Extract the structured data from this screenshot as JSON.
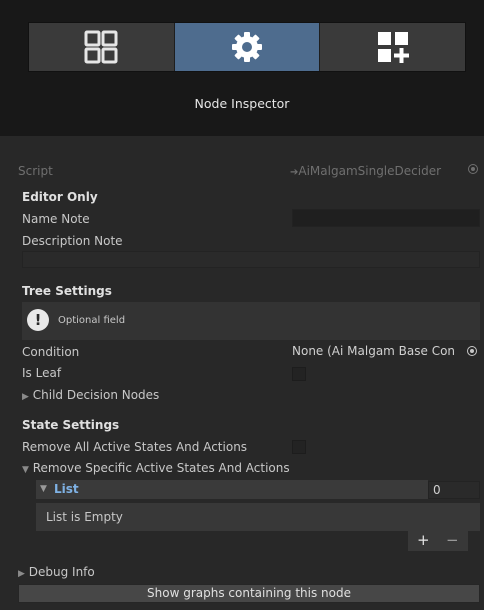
{
  "toolbar": {
    "buttons": [
      {
        "icon": "grid-icon"
      },
      {
        "icon": "gear-icon",
        "active": true
      },
      {
        "icon": "add-block-icon"
      }
    ]
  },
  "title": "Node Inspector",
  "script": {
    "label": "Script",
    "value_arrow": "➔",
    "value": "AiMalgamSingleDecider"
  },
  "editor_only": {
    "header": "Editor Only",
    "name_note_label": "Name Note",
    "name_note_value": "",
    "description_note_label": "Description Note",
    "description_note_value": ""
  },
  "tree_settings": {
    "header": "Tree Settings",
    "info": "Optional field",
    "condition_label": "Condition",
    "condition_value": "None (Ai Malgam Base Con",
    "is_leaf_label": "Is Leaf",
    "is_leaf": false,
    "child_nodes_label": "Child Decision Nodes"
  },
  "state_settings": {
    "header": "State Settings",
    "remove_all_label": "Remove All Active States And Actions",
    "remove_all": false,
    "remove_specific_label": "Remove Specific Active States And Actions",
    "list_label": "List",
    "list_count": "0",
    "list_empty": "List is Empty",
    "add": "+",
    "remove": "−"
  },
  "debug_label": "Debug Info",
  "show_graphs_button": "Show graphs containing this node",
  "colors": {
    "accent": "#4e6c8e",
    "panel": "#282828",
    "background": "#181818"
  }
}
